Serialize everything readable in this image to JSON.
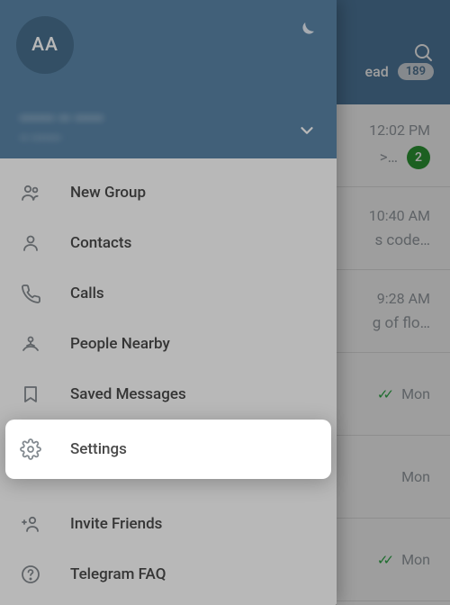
{
  "header": {
    "tab_label": "ead",
    "tab_badge": "189"
  },
  "chats": [
    {
      "time": "12:02 PM",
      "preview": ">…",
      "unread": "2"
    },
    {
      "time": "10:40 AM",
      "preview": "s code…"
    },
    {
      "time": "9:28 AM",
      "preview": "g of flo…"
    },
    {
      "time": "Mon",
      "checks": true
    },
    {
      "time": "Mon"
    },
    {
      "time": "Mon",
      "checks": true
    }
  ],
  "profile": {
    "initials": "AA",
    "name": "•••••• •• •••••",
    "phone": "•• •••••••"
  },
  "menu": {
    "new_group": "New Group",
    "contacts": "Contacts",
    "calls": "Calls",
    "people_nearby": "People Nearby",
    "saved_messages": "Saved Messages",
    "settings": "Settings",
    "invite_friends": "Invite Friends",
    "telegram_faq": "Telegram FAQ"
  }
}
